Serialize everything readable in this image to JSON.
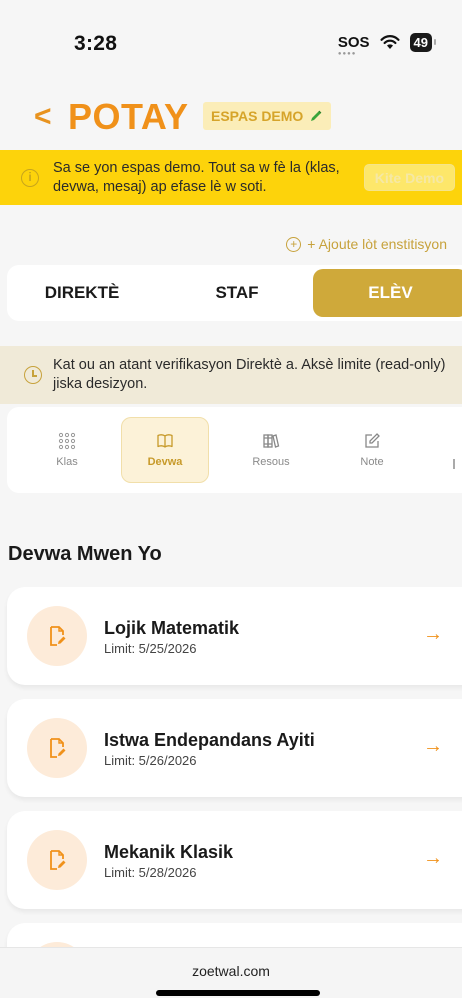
{
  "status_bar": {
    "time": "3:28",
    "sos": "SOS",
    "battery": "49"
  },
  "header": {
    "title": "POTAY",
    "badge": "ESPAS DEMO"
  },
  "demo_banner": {
    "text": "Sa se yon espas demo. Tout sa w fè la (klas, devwa, mesaj) ap efase lè w soti.",
    "exit_label": "Kite Demo"
  },
  "add_institution": {
    "label": "+ Ajoute lòt enstitisyon"
  },
  "role_tabs": [
    {
      "label": "DIREKTÈ"
    },
    {
      "label": "STAF"
    },
    {
      "label": "ELÈV",
      "active": true
    }
  ],
  "verify_notice": {
    "text": "Kat ou an atant verifikasyon Direktè a. Aksè limite (read-only) jiska desizyon."
  },
  "modules": [
    {
      "label": "Klas",
      "icon": "grid-icon"
    },
    {
      "label": "Devwa",
      "icon": "book-icon",
      "active": true
    },
    {
      "label": "Resous",
      "icon": "library-icon"
    },
    {
      "label": "Note",
      "icon": "edit-note-icon"
    }
  ],
  "section_title": "Devwa Mwen Yo",
  "assignments": [
    {
      "title": "Lojik Matematik",
      "due": "Limit: 5/25/2026"
    },
    {
      "title": "Istwa Endepandans Ayiti",
      "due": "Limit: 5/26/2026"
    },
    {
      "title": "Mekanik Klasik",
      "due": "Limit: 5/28/2026"
    }
  ],
  "footer": {
    "domain": "zoetwal.com"
  },
  "colors": {
    "accent": "#f0911a",
    "gold": "#cfa93a",
    "banner": "#fdd30b"
  }
}
